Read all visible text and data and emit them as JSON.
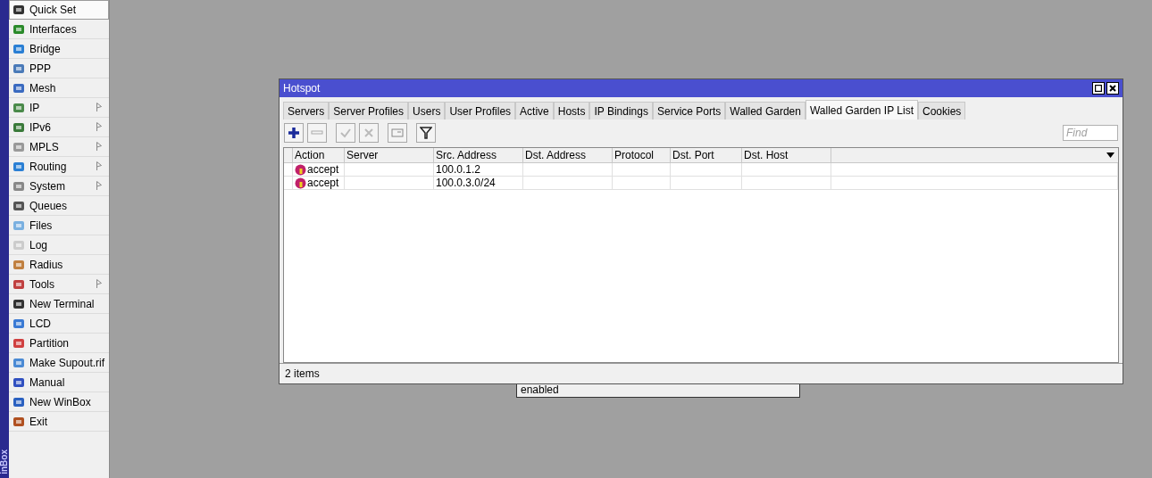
{
  "sidebar": {
    "brand": "inBox",
    "items": [
      {
        "label": "Quick Set",
        "selected": true,
        "has_submenu": false
      },
      {
        "label": "Interfaces",
        "selected": false,
        "has_submenu": false
      },
      {
        "label": "Bridge",
        "selected": false,
        "has_submenu": false
      },
      {
        "label": "PPP",
        "selected": false,
        "has_submenu": false
      },
      {
        "label": "Mesh",
        "selected": false,
        "has_submenu": false
      },
      {
        "label": "IP",
        "selected": false,
        "has_submenu": true
      },
      {
        "label": "IPv6",
        "selected": false,
        "has_submenu": true
      },
      {
        "label": "MPLS",
        "selected": false,
        "has_submenu": true
      },
      {
        "label": "Routing",
        "selected": false,
        "has_submenu": true
      },
      {
        "label": "System",
        "selected": false,
        "has_submenu": true
      },
      {
        "label": "Queues",
        "selected": false,
        "has_submenu": false
      },
      {
        "label": "Files",
        "selected": false,
        "has_submenu": false
      },
      {
        "label": "Log",
        "selected": false,
        "has_submenu": false
      },
      {
        "label": "Radius",
        "selected": false,
        "has_submenu": false
      },
      {
        "label": "Tools",
        "selected": false,
        "has_submenu": true
      },
      {
        "label": "New Terminal",
        "selected": false,
        "has_submenu": false
      },
      {
        "label": "LCD",
        "selected": false,
        "has_submenu": false
      },
      {
        "label": "Partition",
        "selected": false,
        "has_submenu": false
      },
      {
        "label": "Make Supout.rif",
        "selected": false,
        "has_submenu": false
      },
      {
        "label": "Manual",
        "selected": false,
        "has_submenu": false
      },
      {
        "label": "New WinBox",
        "selected": false,
        "has_submenu": false
      },
      {
        "label": "Exit",
        "selected": false,
        "has_submenu": false
      }
    ]
  },
  "window": {
    "title": "Hotspot",
    "tabs": [
      {
        "label": "Servers",
        "selected": false
      },
      {
        "label": "Server Profiles",
        "selected": false
      },
      {
        "label": "Users",
        "selected": false
      },
      {
        "label": "User Profiles",
        "selected": false
      },
      {
        "label": "Active",
        "selected": false
      },
      {
        "label": "Hosts",
        "selected": false
      },
      {
        "label": "IP Bindings",
        "selected": false
      },
      {
        "label": "Service Ports",
        "selected": false
      },
      {
        "label": "Walled Garden",
        "selected": false
      },
      {
        "label": "Walled Garden IP List",
        "selected": true
      },
      {
        "label": "Cookies",
        "selected": false
      }
    ],
    "search": {
      "placeholder": "Find"
    },
    "table": {
      "columns": [
        "Action",
        "Server",
        "Src. Address",
        "Dst. Address",
        "Protocol",
        "Dst. Port",
        "Dst. Host"
      ],
      "rows": [
        {
          "cells": [
            "accept",
            "",
            "100.0.1.2",
            "",
            "",
            "",
            ""
          ]
        },
        {
          "cells": [
            "accept",
            "",
            "100.0.3.0/24",
            "",
            "",
            "",
            ""
          ]
        }
      ]
    },
    "status_bar": "2 items"
  },
  "background_window": {
    "text": "enabled"
  }
}
